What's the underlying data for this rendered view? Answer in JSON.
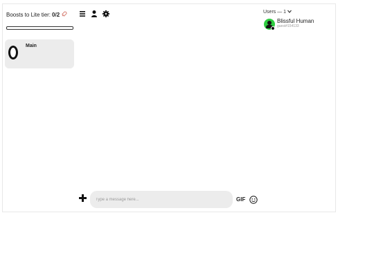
{
  "sidebar": {
    "boost_label": "Boosts to Lite tier:",
    "boost_count": "0/2",
    "boost_icon": "rocket-icon",
    "boost_progress": 0,
    "server": {
      "name": "Main",
      "icon": "server-ring-icon"
    }
  },
  "toolbar": {
    "icons": [
      "menu-icon",
      "user-icon",
      "gear-icon"
    ]
  },
  "users": {
    "heading": "Users — 1",
    "heading_icon": "chevron-down-icon",
    "list": [
      {
        "name": "Blissful Human",
        "status": "guest#154133",
        "avatar_color": "#2ecc40"
      }
    ]
  },
  "composer": {
    "add_icon": "plus-icon",
    "placeholder": "Type a message here...",
    "gif_label": "GIF",
    "emoji_icon": "smiley-icon"
  }
}
